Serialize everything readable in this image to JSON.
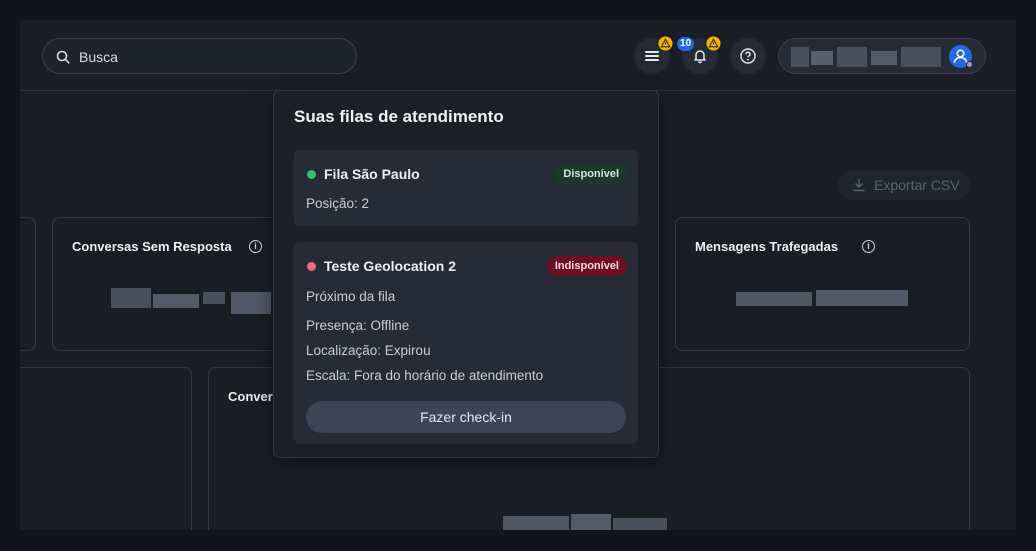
{
  "header": {
    "search_placeholder": "Busca",
    "notifications_count": "10",
    "icons": [
      "search-icon",
      "queue-list-icon",
      "bell-icon",
      "help-icon",
      "user-icon",
      "warning-icon"
    ],
    "colors": {
      "accent": "#2566e8",
      "warning": "#f4b400",
      "available": "#33c36d",
      "unavailable": "#f06a7a"
    }
  },
  "toolbar": {
    "export_label": "Exportar CSV"
  },
  "cards": {
    "unanswered_title": "Conversas Sem Resposta",
    "messages_title": "Mensagens Trafegadas",
    "conversations_title_partial": "Conver"
  },
  "queues_popover": {
    "title": "Suas filas de atendimento",
    "queues": [
      {
        "name": "Fila São Paulo",
        "status": "Disponível",
        "lines": [
          "Posição: 2"
        ]
      },
      {
        "name": "Teste Geolocation 2",
        "status": "Indisponível",
        "lines": [
          "Próximo da fila",
          "Presença: Offline",
          "Localização: Expirou",
          "Escala: Fora do horário de atendimento"
        ],
        "action": "Fazer check-in"
      }
    ]
  }
}
